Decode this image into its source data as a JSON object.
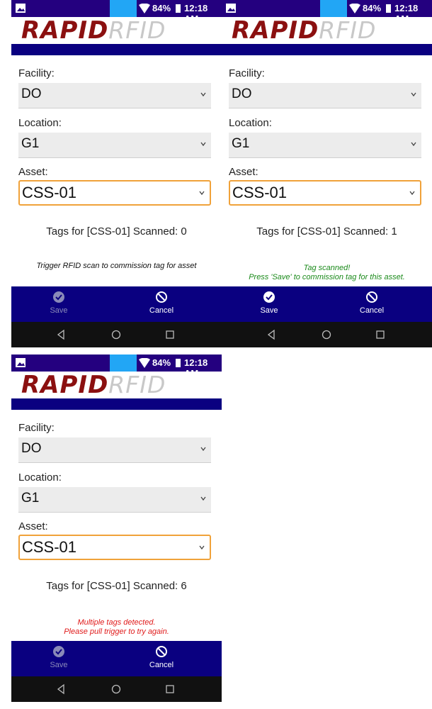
{
  "status": {
    "battery_pct": "84%",
    "time": "12:18 AM"
  },
  "logo": {
    "rapid": "RAPID",
    "rfid": "RFID"
  },
  "form": {
    "facility_label": "Facility:",
    "facility_value": "DO",
    "location_label": "Location:",
    "location_value": "G1",
    "asset_label": "Asset:",
    "asset_value": "CSS-01"
  },
  "actions": {
    "save_label": "Save",
    "cancel_label": "Cancel"
  },
  "screens": [
    {
      "tags_text": "Tags for [CSS-01] Scanned: 0",
      "message_lines": [
        "Trigger RFID scan to commission tag for asset"
      ],
      "message_color": "#111111",
      "save_enabled": false
    },
    {
      "tags_text": "Tags for [CSS-01] Scanned: 1",
      "message_lines": [
        "Tag scanned!",
        "Press 'Save' to commission tag for this asset."
      ],
      "message_color": "#1a8a1a",
      "save_enabled": true
    },
    {
      "tags_text": "Tags for [CSS-01] Scanned: 6",
      "message_lines": [
        "Multiple tags detected.",
        "Please pull trigger to try again."
      ],
      "message_color": "#e01b1b",
      "save_enabled": false
    }
  ],
  "colors": {
    "status_bar": "#24007f",
    "header_bar": "#0a0080",
    "logo_red": "#8b1010",
    "focus_border": "#f0a23a"
  },
  "icons": [
    "image-icon",
    "wifi-icon",
    "battery-icon",
    "checkmark-icon",
    "cancel-icon",
    "back-icon",
    "home-icon",
    "recents-icon",
    "chevron-down-icon"
  ]
}
